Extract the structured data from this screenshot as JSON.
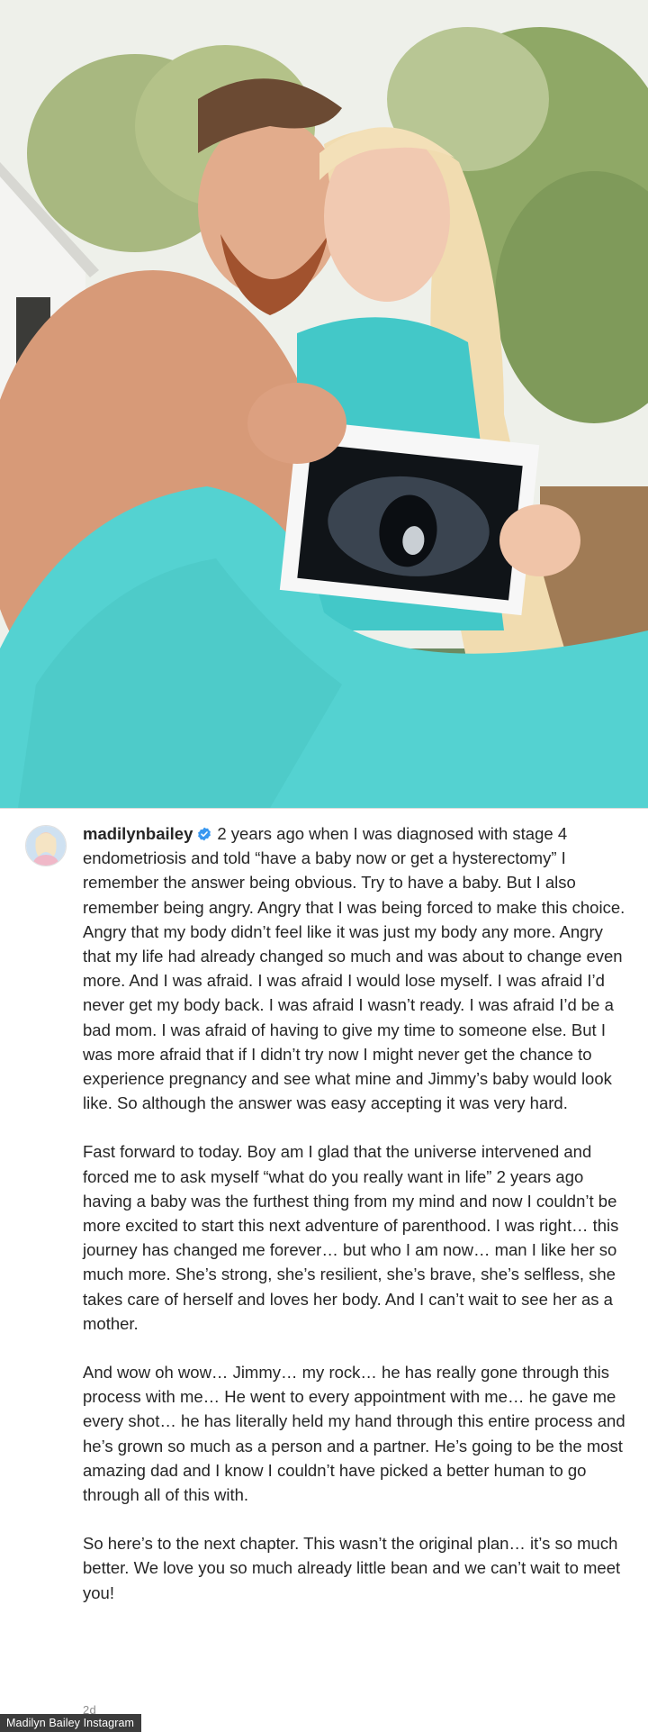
{
  "post": {
    "username": "madilynbailey",
    "verified_icon": "verified-badge-icon",
    "paragraphs": [
      "2 years ago when I was diagnosed with stage 4 endometriosis and told “have a baby now or get a hysterectomy” I remember the answer being obvious. Try to have a baby. But I also remember being angry. Angry that I was being forced to make this choice. Angry that my body didn’t feel like it was just my body any more. Angry that my life had already changed so much and was about to change even more. And I was afraid. I was afraid I would lose myself. I was afraid I’d never get my body back. I was afraid I wasn’t ready. I was afraid I’d be a bad mom. I was afraid of having to give my time to someone else. But I was more afraid that if I didn’t try now I might never get the chance to experience pregnancy and see what mine and Jimmy’s baby would look like. So although the answer was easy accepting it was very hard.",
      "Fast forward to today. Boy am I glad that the universe intervened and forced me to ask myself “what do you really want in life” 2 years ago having a baby was the furthest thing from my mind and now I couldn’t be more excited to start this next adventure of parenthood. I was right… this journey has changed me forever… but who I am now… man I like her so much more. She’s strong, she’s resilient, she’s brave, she’s selfless, she takes care of herself and loves her body. And I can’t wait to see her as a mother.",
      "And wow oh wow… Jimmy… my rock… he has really gone through this process with me… He went to every appointment with me… he gave me every shot… he has literally held my hand through this entire process and he’s grown so much as a person and a partner. He’s going to be the most amazing dad and I know I couldn’t have picked a better human to go through all of this with.",
      "So here’s to the next chapter. This wasn’t the original plan… it’s so much better. We love you so much already little bean and we can’t wait to meet you!"
    ],
    "timestamp": "2d"
  },
  "credit": "Madilyn Bailey Instagram",
  "colors": {
    "text": "#262626",
    "muted": "#8e8e8e",
    "verified": "#3897f0",
    "credit_bg": "#3c3c3c"
  }
}
